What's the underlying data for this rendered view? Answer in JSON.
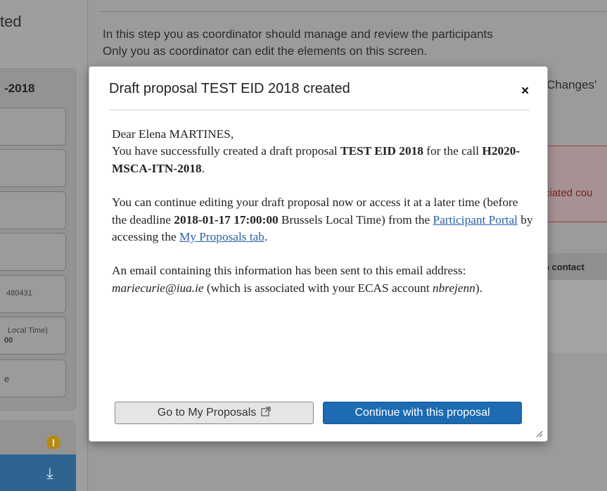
{
  "background": {
    "page_title": "ted",
    "sidebar_title": "-2018",
    "sidebar_boxes": [
      "",
      "",
      "",
      "",
      "480431",
      "Local Time)",
      "e"
    ],
    "sidebar_box_extra": "00",
    "intro_line1": "In this step you as coordinator should manage and review the participants",
    "intro_line2": "Only you as coordinator can edit the elements on this screen.",
    "changes_text": "Changes'",
    "alert_text": "ciated cou",
    "table_header": "n contact"
  },
  "modal": {
    "title": "Draft proposal TEST EID 2018 created",
    "close_symbol": "×",
    "greeting": "Dear Elena MARTINES,",
    "p1_a": "You have successfully created a draft proposal ",
    "p1_b": "TEST EID 2018",
    "p1_c": " for the call ",
    "p1_d": "H2020-MSCA-ITN-2018",
    "p1_e": ".",
    "p2_a": "You can continue editing your draft proposal now or access it at a later time (before the deadline ",
    "p2_b": "2018-01-17 17:00:00",
    "p2_c": " Brussels Local Time) from the ",
    "p2_link1": "Participant Portal",
    "p2_d": " by accessing the ",
    "p2_link2": "My Proposals tab",
    "p2_e": ".",
    "p3_a": "An email containing this information has been sent to this email address: ",
    "p3_email": "mariecurie@iua.ie",
    "p3_b": " (which is associated with your ECAS account ",
    "p3_account": "nbrejenn",
    "p3_c": ").",
    "btn_secondary": "Go to My Proposals",
    "btn_primary": "Continue with this proposal"
  },
  "icons": {
    "close": "close-icon",
    "external": "external-link-icon",
    "warning": "warning-icon",
    "download": "download-icon",
    "resize": "resize-grip-icon"
  },
  "colors": {
    "primary_button": "#1c6bb3",
    "link": "#2a62a8",
    "warning": "#e0a800"
  }
}
